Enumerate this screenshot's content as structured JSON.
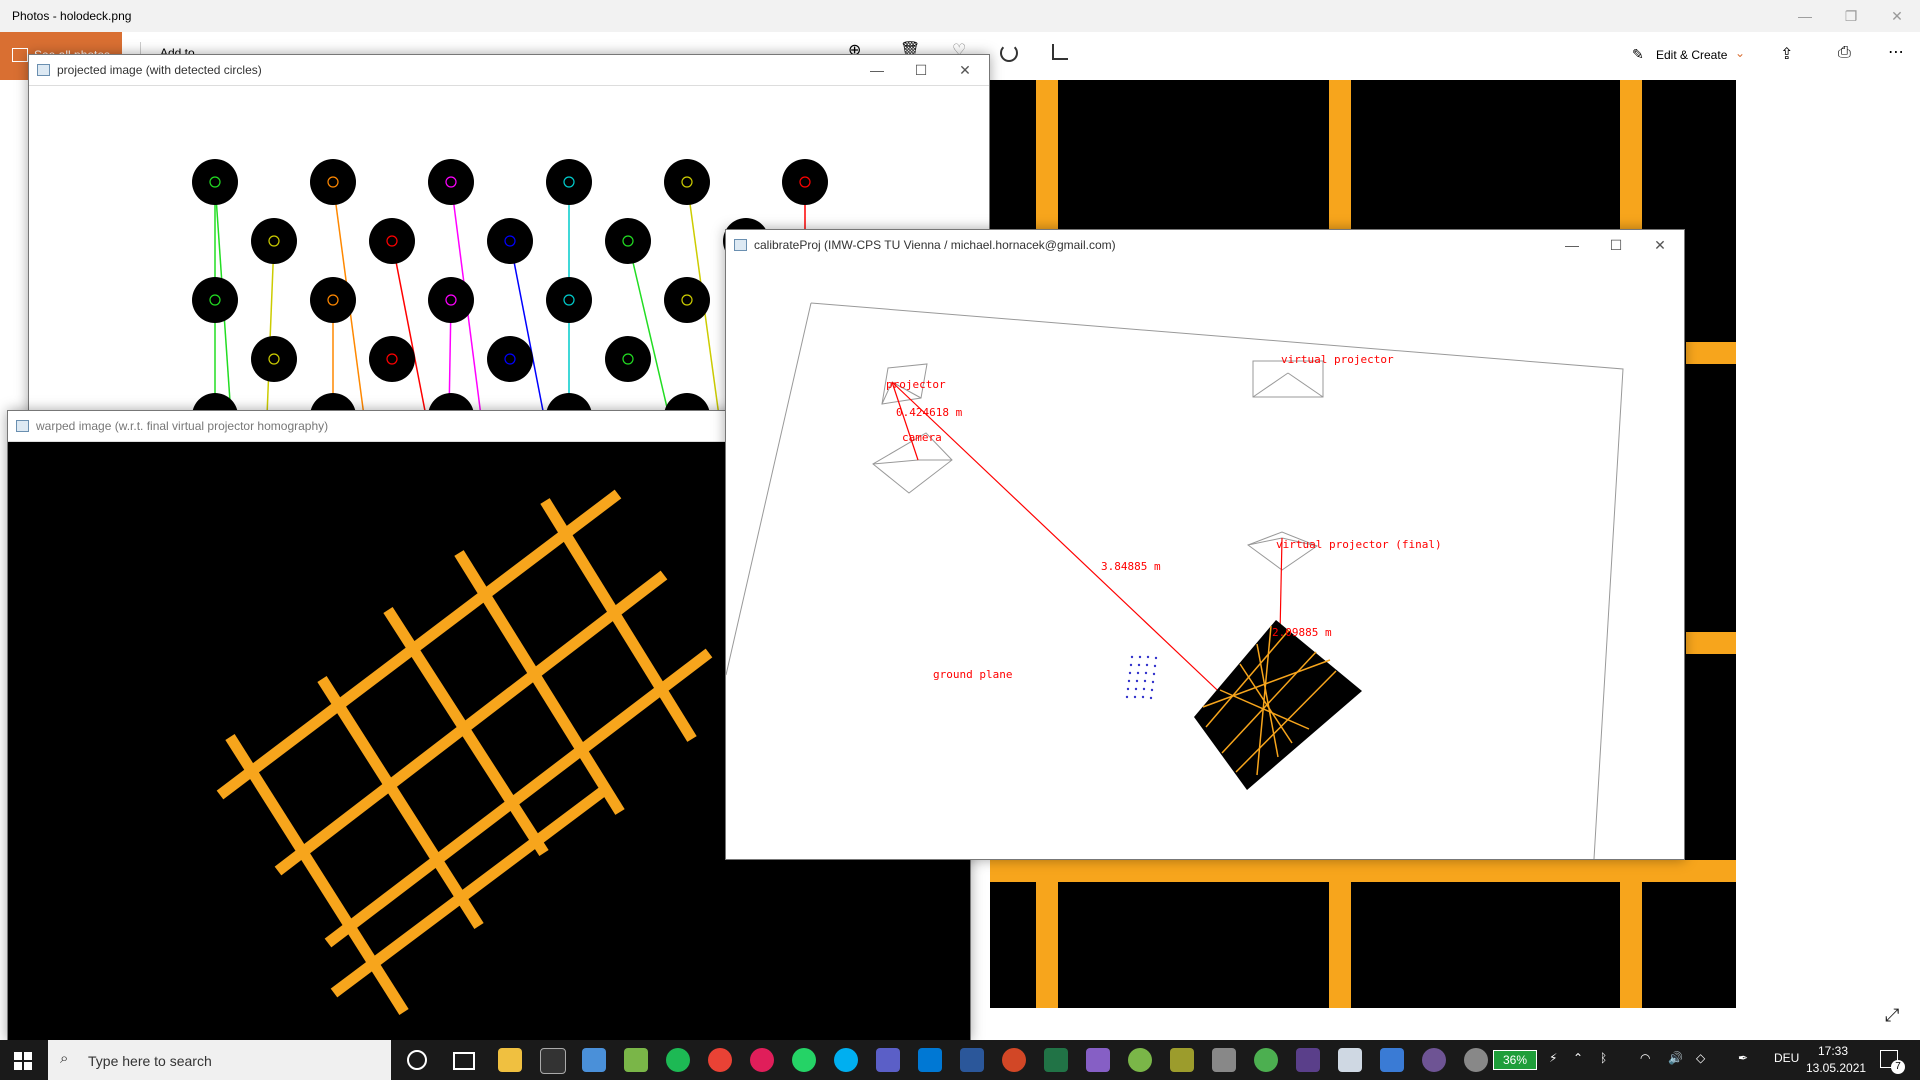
{
  "photos": {
    "title": "Photos - holodeck.png",
    "see_all_label": "See all photos",
    "add_to_label": "Add to",
    "edit_create_label": "Edit & Create",
    "colors": {
      "orange": "#f7a51c",
      "accent": "#d96f32"
    }
  },
  "win_projected": {
    "title": "projected image (with detected circles)"
  },
  "win_warped": {
    "title": "warped image (w.r.t. final virtual projector homography)"
  },
  "win_calib": {
    "title": "calibrateProj (IMW-CPS TU Vienna / michael.hornacek@gmail.com)",
    "labels": {
      "projector": "projector",
      "camera": "camera",
      "virtual_projector": "virtual projector",
      "virtual_projector_final": "virtual projector (final)",
      "ground_plane": "ground plane",
      "dist_1": "0.424618 m",
      "dist_2": "3.84885 m",
      "dist_3": "2.09885 m"
    },
    "colors": {
      "annotation": "#ff0000"
    }
  },
  "taskbar": {
    "search_placeholder": "Type here to search",
    "battery": "36%",
    "language": "DEU",
    "time": "17:33",
    "date": "13.05.2021",
    "notifications": "7"
  }
}
